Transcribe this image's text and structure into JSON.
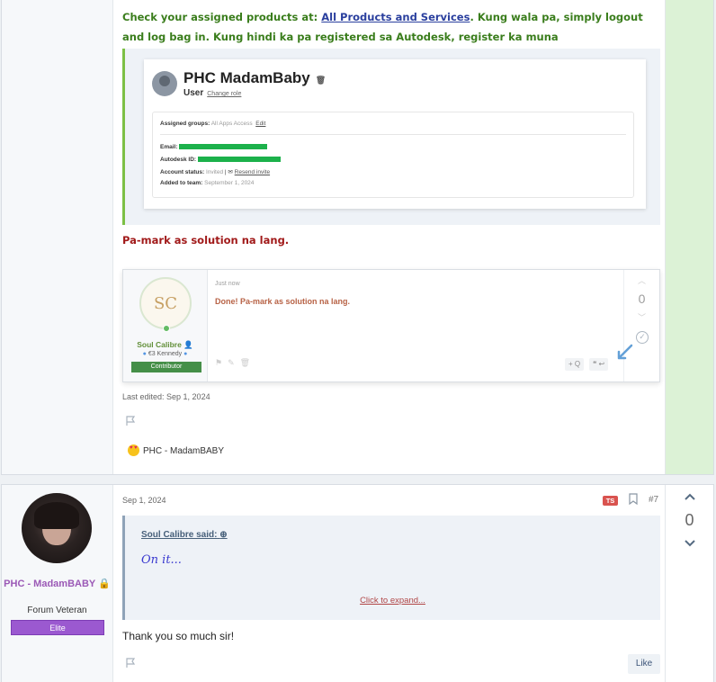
{
  "post1": {
    "intro_text_pre": "Check your assigned products at: ",
    "intro_link": "All Products and Services",
    "intro_text_post": ". Kung wala pa, simply logout and log bag in. Kung hindi ka pa registered sa Autodesk, register ka muna",
    "account_card": {
      "name": "PHC MadamBaby",
      "role": "User",
      "change_role": "Change role",
      "assigned_groups_label": "Assigned groups:",
      "assigned_groups_value": "All Apps Access",
      "edit_link": "Edit",
      "email_label": "Email:",
      "autodesk_id_label": "Autodesk ID:",
      "account_status_label": "Account status:",
      "account_status_value": "Invited",
      "resend_invite": "Resend invite",
      "added_label": "Added to team:",
      "added_value": "September 1, 2024"
    },
    "instruction_text": "Pa-mark as solution na lang.",
    "embedded_post": {
      "logo_text": "SC",
      "username": "Soul Calibre",
      "sub_user": "€3 Kennedy",
      "badge": "Contributor",
      "time": "Just now",
      "message": "Done! Pa-mark as solution na lang.",
      "vote_count": "0",
      "quote_btn": "+ Q"
    },
    "last_edited": "Last edited: Sep 1, 2024",
    "reaction_user": "PHC - MadamBABY"
  },
  "post2": {
    "username": "PHC - MadamBABY",
    "user_title": "Forum Veteran",
    "badge": "Elite",
    "date": "Sep 1, 2024",
    "ts_badge": "TS",
    "post_number": "#7",
    "quote_attribution": "Soul Calibre said:",
    "quote_text": "On it...",
    "click_to_expand": "Click to expand...",
    "message": "Thank you so much sir!",
    "like_label": "Like",
    "vote_count": "0"
  },
  "colors": {
    "green_text": "#3a7d1c",
    "red_text": "#a11a1a",
    "username_purple": "#9b59b6",
    "elite_badge": "#9b59d0",
    "solution_bg": "#dcf2d6"
  }
}
